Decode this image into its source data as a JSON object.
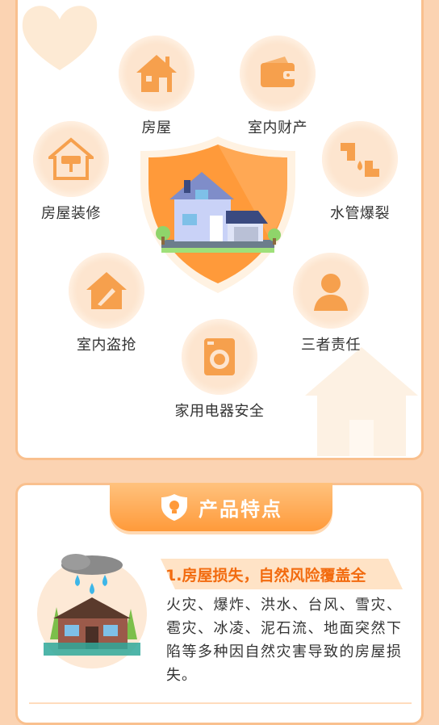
{
  "coverage": {
    "items": [
      {
        "label": "房屋",
        "icon": "house-icon"
      },
      {
        "label": "室内财产",
        "icon": "wallet-icon"
      },
      {
        "label": "房屋装修",
        "icon": "renovation-icon"
      },
      {
        "label": "水管爆裂",
        "icon": "water-pipe-icon"
      },
      {
        "label": "室内盗抢",
        "icon": "knife-icon"
      },
      {
        "label": "三者责任",
        "icon": "person-icon"
      },
      {
        "label": "家用电器安全",
        "icon": "washing-machine-icon"
      }
    ]
  },
  "features": {
    "header_title": "产品特点",
    "header_icon": "shield-bulb-icon",
    "item1": {
      "title": "1.房屋损失，自然风险覆盖全",
      "description": "火灾、爆炸、洪水、台风、雪灾、雹灾、冰凌、泥石流、地面突然下陷等多种因自然灾害导致的房屋损失。"
    }
  },
  "colors": {
    "background": "#fbd3b2",
    "accent": "#ff9a3a",
    "icon_orange": "#f6a04d",
    "title_orange": "#f26b0f"
  }
}
